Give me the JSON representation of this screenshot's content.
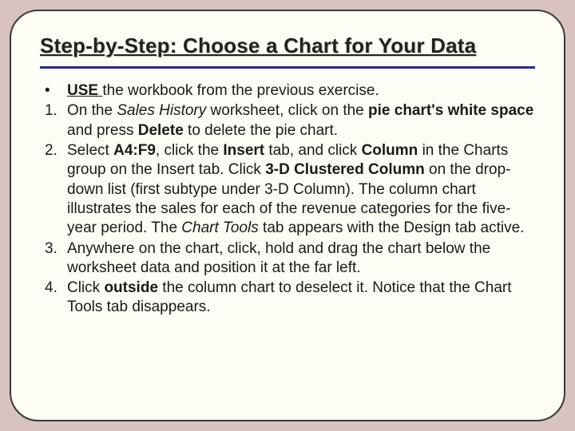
{
  "title": "Step-by-Step: Choose a Chart for Your Data",
  "bullet": {
    "marker": "•",
    "pre_bold": "USE ",
    "rest": "the workbook from the previous exercise."
  },
  "steps": [
    {
      "marker": "1.",
      "parts": [
        {
          "t": "On the "
        },
        {
          "t": "Sales History",
          "cls": "i"
        },
        {
          "t": " worksheet, click on the "
        },
        {
          "t": "pie chart's white space",
          "cls": "b"
        },
        {
          "t": " and press "
        },
        {
          "t": "Delete",
          "cls": "b"
        },
        {
          "t": " to delete the pie chart."
        }
      ]
    },
    {
      "marker": "2.",
      "parts": [
        {
          "t": "Select "
        },
        {
          "t": "A4:F9",
          "cls": "b"
        },
        {
          "t": ", click the "
        },
        {
          "t": "Insert",
          "cls": "b"
        },
        {
          "t": " tab, and click "
        },
        {
          "t": "Column",
          "cls": "b"
        },
        {
          "t": " in the Charts group on the Insert tab. Click "
        },
        {
          "t": "3-D Clustered Column",
          "cls": "b"
        },
        {
          "t": " on the drop-down list (first subtype under 3-D Column). The column chart illustrates the sales for each of the revenue categories for the five-year period. The "
        },
        {
          "t": "Chart Tools",
          "cls": "i"
        },
        {
          "t": " tab appears with the Design tab active."
        }
      ]
    },
    {
      "marker": "3.",
      "parts": [
        {
          "t": "Anywhere on the chart, click, hold and drag the chart below the worksheet data and position it at the far left."
        }
      ]
    },
    {
      "marker": "4.",
      "parts": [
        {
          "t": "Click "
        },
        {
          "t": "outside",
          "cls": "b"
        },
        {
          "t": " the column chart to deselect it. Notice that the Chart Tools tab disappears."
        }
      ]
    }
  ]
}
